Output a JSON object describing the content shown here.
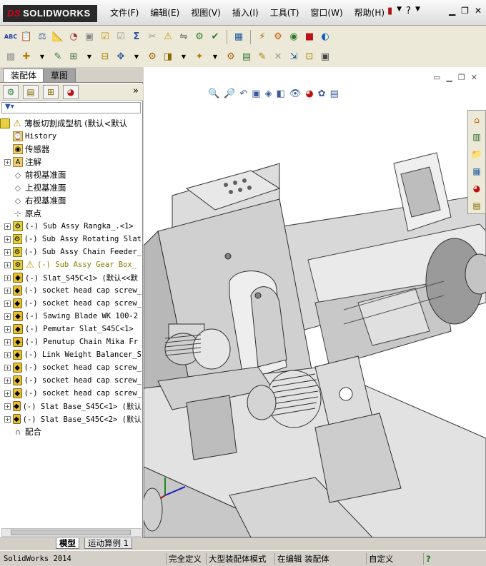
{
  "app": {
    "brand": "SOLIDWORKS",
    "brand_prefix": "DS"
  },
  "menus": [
    "文件(F)",
    "编辑(E)",
    "视图(V)",
    "插入(I)",
    "工具(T)",
    "窗口(W)",
    "帮助(H)"
  ],
  "left_panel": {
    "tabs": [
      "装配体",
      "草图"
    ],
    "tree": {
      "root": "薄板切割成型机  (默认<默认",
      "items": [
        {
          "label": "History",
          "icon": "history-icon",
          "expand": false
        },
        {
          "label": "传感器",
          "icon": "sensor-icon",
          "expand": false
        },
        {
          "label": "注解",
          "icon": "annotation-icon",
          "expand": true
        },
        {
          "label": "前视基准面",
          "icon": "plane-icon",
          "expand": false
        },
        {
          "label": "上视基准面",
          "icon": "plane-icon",
          "expand": false
        },
        {
          "label": "右视基准面",
          "icon": "plane-icon",
          "expand": false
        },
        {
          "label": "原点",
          "icon": "origin-icon",
          "expand": false
        },
        {
          "label": "(-) Sub Assy Rangka_.<1>",
          "icon": "assembly-icon",
          "expand": true
        },
        {
          "label": "(-) Sub Assy Rotating Slat",
          "icon": "assembly-icon",
          "expand": true
        },
        {
          "label": "(-) Sub Assy Chain Feeder_",
          "icon": "assembly-icon",
          "expand": true
        },
        {
          "label": "(-) Sub Assy Gear Box_",
          "icon": "assembly-warning-icon",
          "expand": true,
          "warning": true
        },
        {
          "label": "(-) Slat_S45C<1> (默认<<默",
          "icon": "part-icon",
          "expand": true
        },
        {
          "label": "(-) socket head cap screw_",
          "icon": "part-icon",
          "expand": true
        },
        {
          "label": "(-) socket head cap screw_",
          "icon": "part-icon",
          "expand": true
        },
        {
          "label": "(-) Sawing Blade WK 100-2",
          "icon": "part-icon",
          "expand": true
        },
        {
          "label": "(-) Pemutar Slat_S45C<1>",
          "icon": "part-icon",
          "expand": true
        },
        {
          "label": "(-) Penutup Chain Mika Fr",
          "icon": "part-icon",
          "expand": true
        },
        {
          "label": "(-) Link Weight Balancer_S",
          "icon": "part-icon",
          "expand": true
        },
        {
          "label": "(-) socket head cap screw_",
          "icon": "part-icon",
          "expand": true
        },
        {
          "label": "(-) socket head cap screw_",
          "icon": "part-icon",
          "expand": true
        },
        {
          "label": "(-) socket head cap screw_",
          "icon": "part-icon",
          "expand": true
        },
        {
          "label": "(-) Slat Base_S45C<1> (默认",
          "icon": "part-icon",
          "expand": true
        },
        {
          "label": "(-) Slat Base_S45C<2> (默认",
          "icon": "part-icon",
          "expand": true
        },
        {
          "label": "配合",
          "icon": "mates-icon",
          "expand": false
        }
      ]
    }
  },
  "bottom_tabs": [
    "模型",
    "运动算例 1"
  ],
  "status_bar": {
    "app_version": "SolidWorks 2014",
    "defined": "完全定义",
    "mode": "大型装配体模式",
    "editing": "在编辑 装配体",
    "custom": "自定义",
    "help": "?"
  }
}
